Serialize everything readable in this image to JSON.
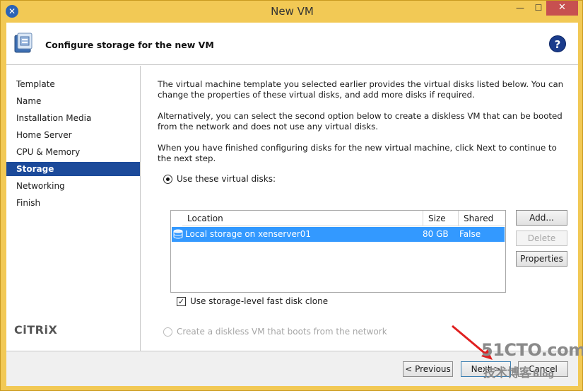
{
  "window": {
    "title": "New VM"
  },
  "header": {
    "title": "Configure storage for the new VM",
    "help": "?"
  },
  "sidebar": {
    "items": [
      {
        "label": "Template"
      },
      {
        "label": "Name"
      },
      {
        "label": "Installation Media"
      },
      {
        "label": "Home Server"
      },
      {
        "label": "CPU & Memory"
      },
      {
        "label": "Storage",
        "active": true
      },
      {
        "label": "Networking"
      },
      {
        "label": "Finish"
      }
    ],
    "logo": "CiTRiX"
  },
  "main": {
    "para1": "The virtual machine template you selected earlier provides the virtual disks listed below. You can change the properties of these virtual disks, and add more disks if required.",
    "para2": "Alternatively, you can select the second option below to create a diskless VM that can be booted from the network and does not use any virtual disks.",
    "para3": "When you have finished configuring disks for the new virtual machine, click Next to continue to the next step.",
    "option_disks": "Use these virtual disks:",
    "option_diskless": "Create a diskless VM that boots from the network",
    "fast_clone": "Use storage-level fast disk clone",
    "table": {
      "columns": [
        "Location",
        "Size",
        "Shared"
      ],
      "rows": [
        {
          "location": "Local storage on xenserver01",
          "size": "80 GB",
          "shared": "False"
        }
      ]
    },
    "buttons": {
      "add": "Add...",
      "delete": "Delete",
      "properties": "Properties"
    }
  },
  "footer": {
    "previous": "< Previous",
    "next": "Next >",
    "cancel": "Cancel"
  },
  "watermark": {
    "line1": "51CTO.com",
    "line2": "技术博客",
    "line2_suffix": "Blog"
  }
}
